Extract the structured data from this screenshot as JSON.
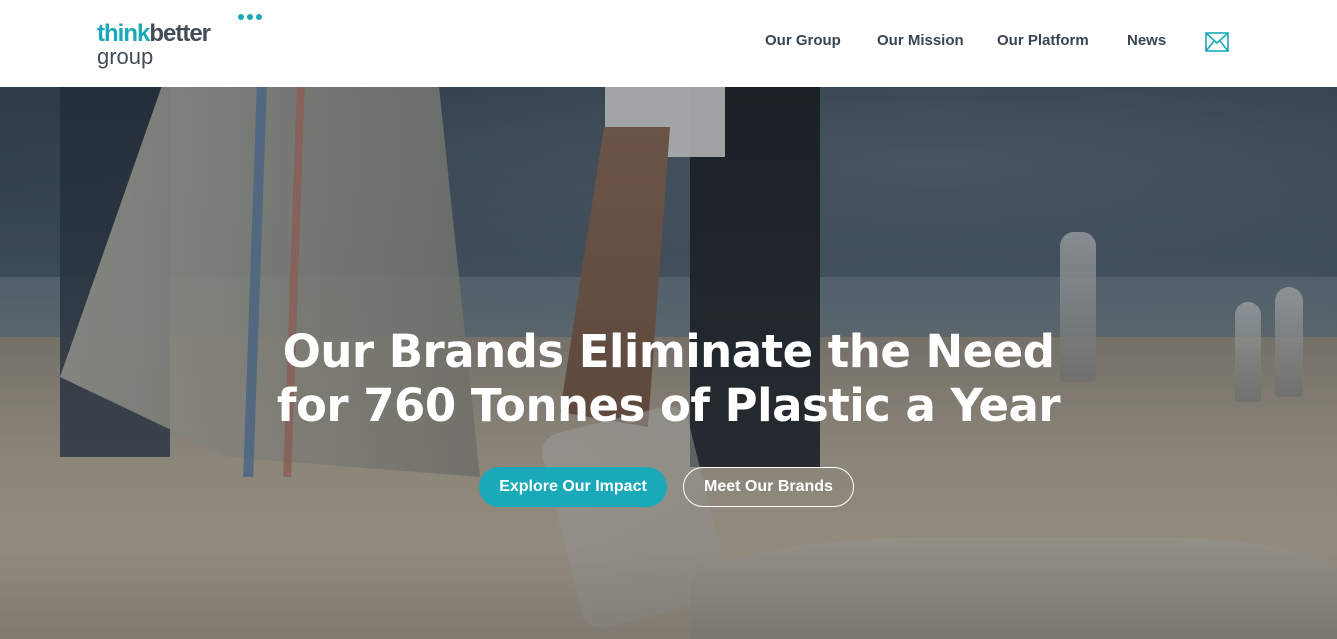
{
  "logo": {
    "think": "think",
    "better": "better",
    "group": "group"
  },
  "nav": {
    "items": [
      {
        "label": "Our Group"
      },
      {
        "label": "Our Mission"
      },
      {
        "label": "Our Platform"
      },
      {
        "label": "News"
      }
    ],
    "contact_icon": "mail-icon"
  },
  "hero": {
    "title_line1": "Our Brands Eliminate the Need",
    "title_line2": "for 760 Tonnes of Plastic a Year",
    "primary_button": "Explore Our Impact",
    "secondary_button": "Meet Our Brands"
  },
  "colors": {
    "accent": "#1aa9b8",
    "nav_text": "#3a4550",
    "hero_text": "#ffffff"
  }
}
